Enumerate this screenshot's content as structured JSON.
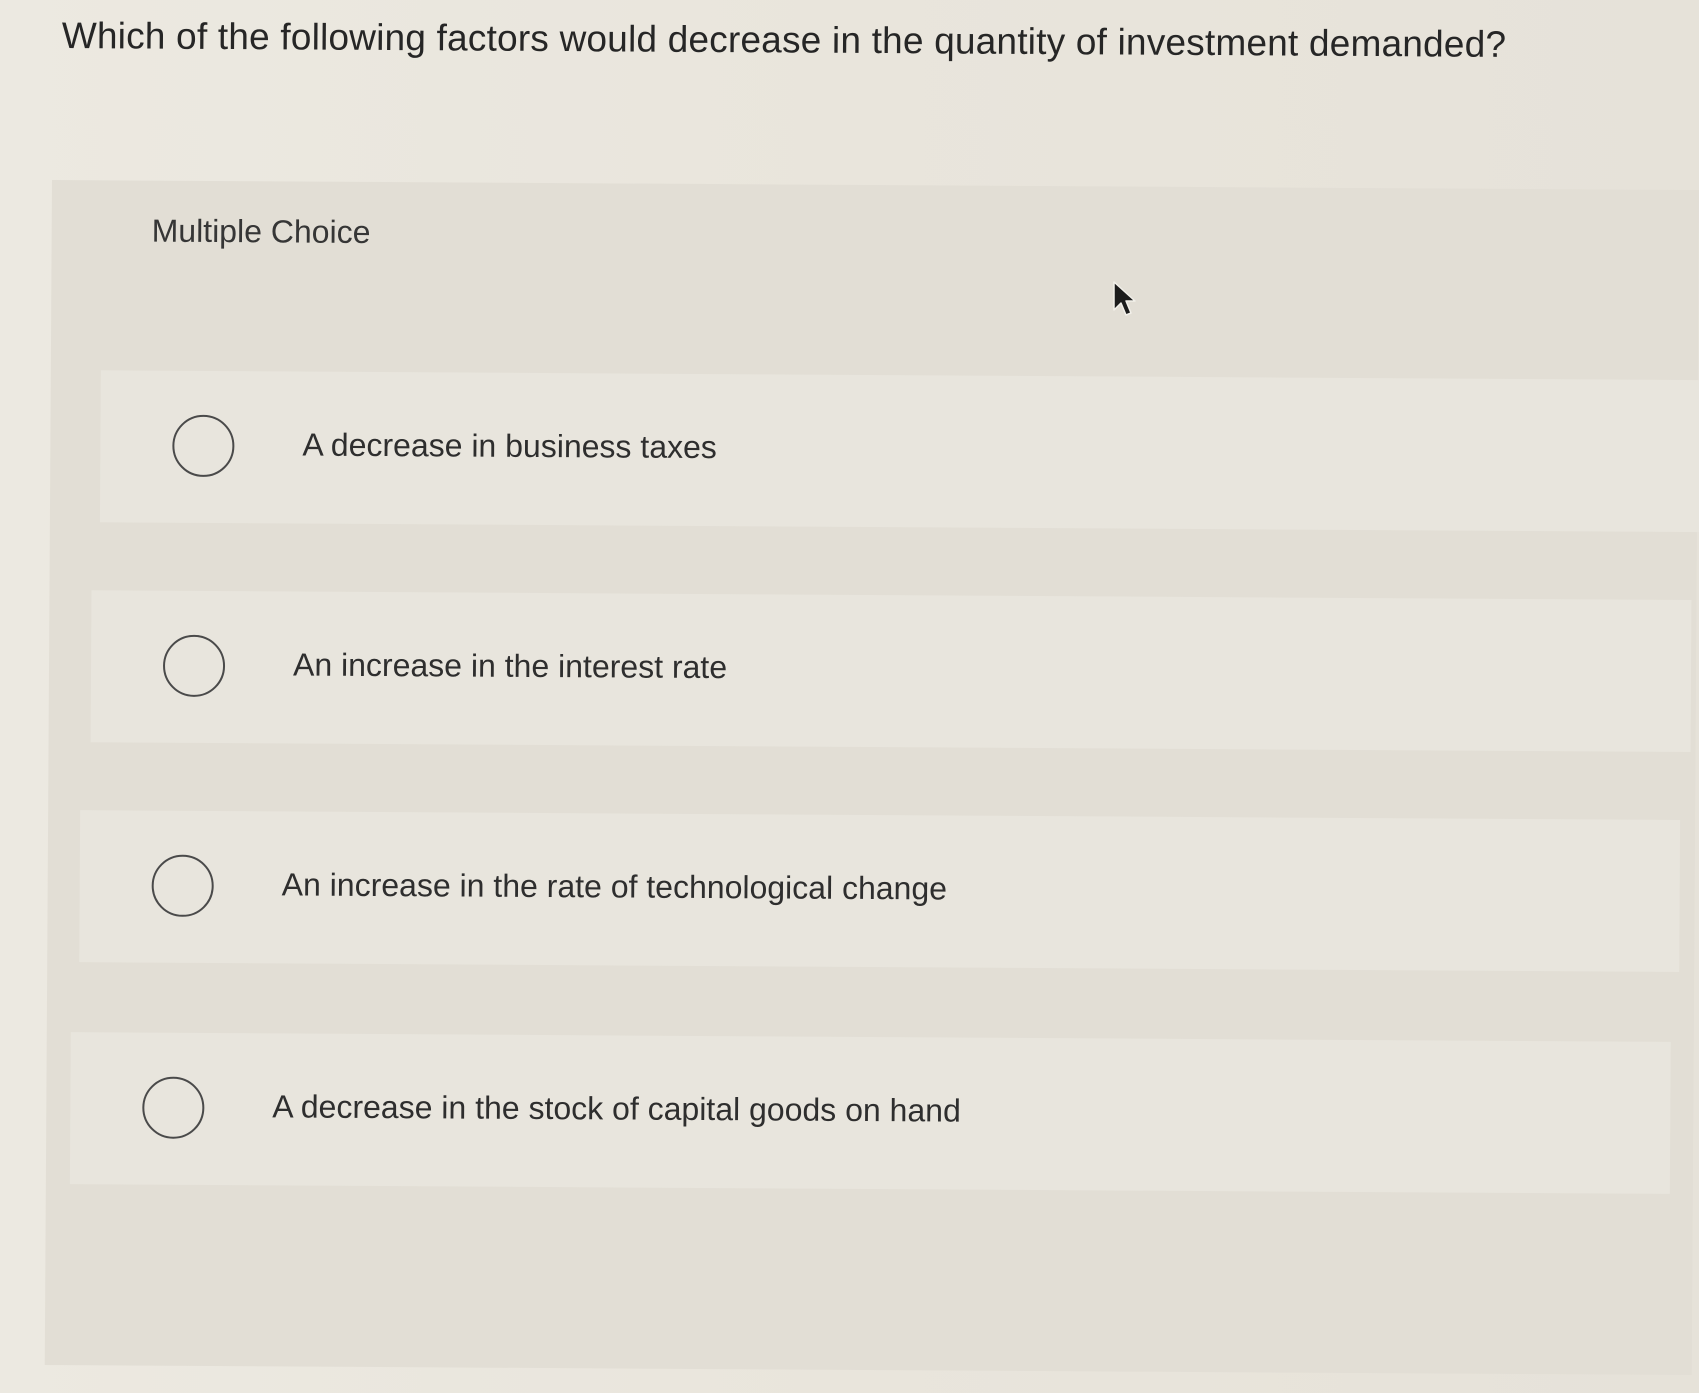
{
  "question": {
    "text": "Which of the following factors would decrease in the quantity of investment demanded?"
  },
  "panel": {
    "header": "Multiple Choice"
  },
  "options": [
    {
      "label": "A decrease in business taxes",
      "selected": false
    },
    {
      "label": "An increase in the interest rate",
      "selected": false
    },
    {
      "label": "An increase in the rate of technological change",
      "selected": false
    },
    {
      "label": "A decrease in the stock of capital goods on hand",
      "selected": false
    }
  ],
  "icons": {
    "cursor": "mouse-pointer-icon",
    "radio": "radio-unselected-icon"
  },
  "colors": {
    "background": "#e9e5dc",
    "panel": "#e2ded5",
    "option_row": "#e8e5dd",
    "text": "#2b2b2b",
    "radio_border": "#4a4a4a"
  }
}
